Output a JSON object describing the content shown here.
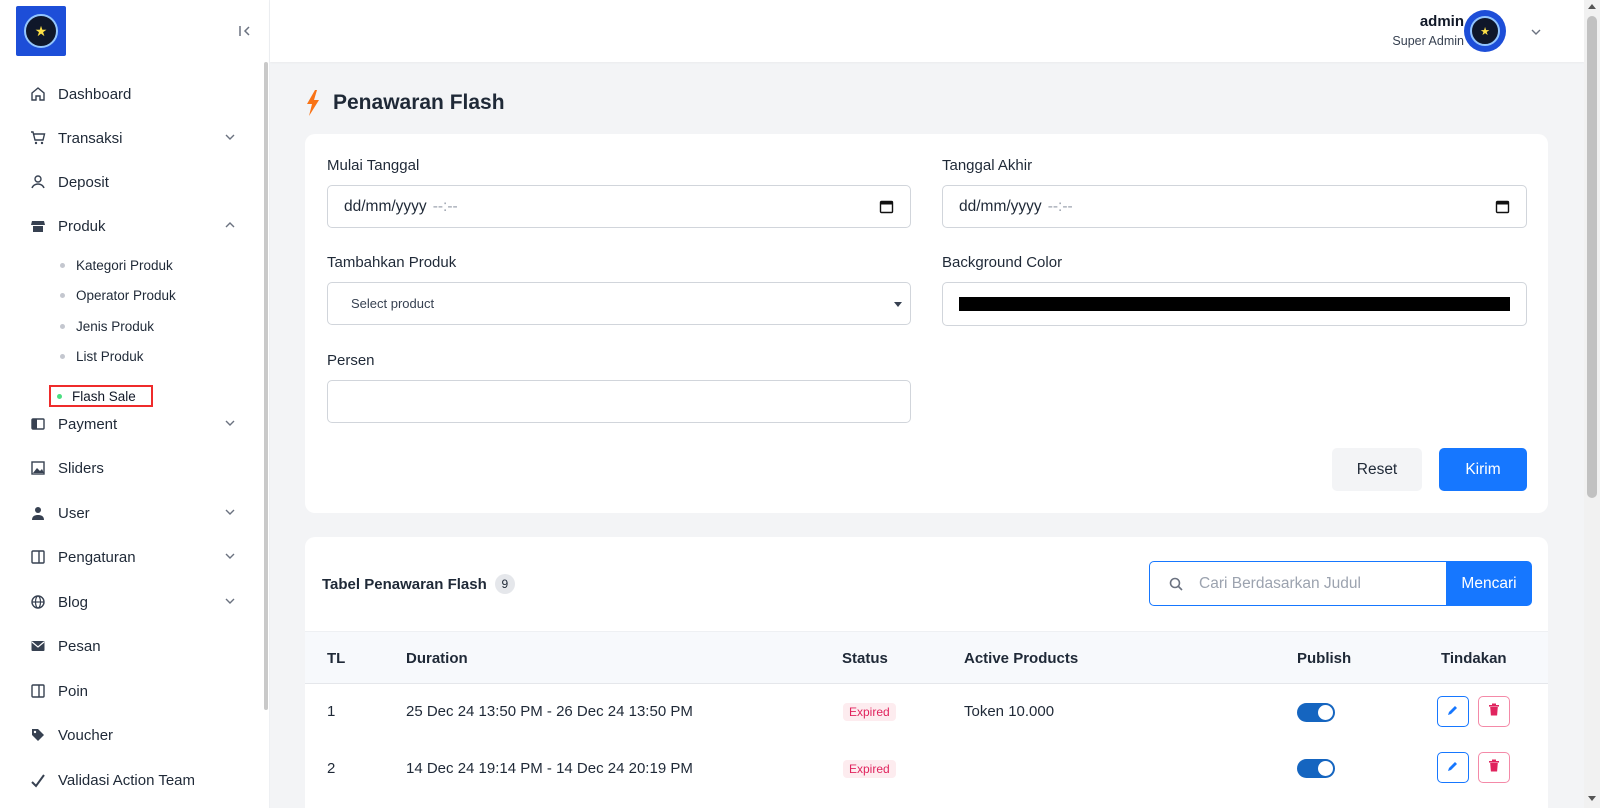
{
  "sidebar": {
    "items": [
      {
        "label": "Dashboard",
        "icon": "home-icon"
      },
      {
        "label": "Transaksi",
        "icon": "cart-icon"
      },
      {
        "label": "Deposit",
        "icon": "deposit-icon"
      },
      {
        "label": "Produk",
        "icon": "store-icon"
      },
      {
        "label": "Payment",
        "icon": "wallet-icon"
      },
      {
        "label": "Sliders",
        "icon": "image-icon"
      },
      {
        "label": "User",
        "icon": "user-icon"
      },
      {
        "label": "Pengaturan",
        "icon": "settings-icon"
      },
      {
        "label": "Blog",
        "icon": "globe-icon"
      },
      {
        "label": "Pesan",
        "icon": "mail-icon"
      },
      {
        "label": "Poin",
        "icon": "points-icon"
      },
      {
        "label": "Voucher",
        "icon": "tag-icon"
      },
      {
        "label": "Validasi Action Team",
        "icon": "check-icon"
      }
    ],
    "produk_sub": [
      {
        "label": "Kategori Produk"
      },
      {
        "label": "Operator Produk"
      },
      {
        "label": "Jenis Produk"
      },
      {
        "label": "List Produk"
      },
      {
        "label": "Flash Sale"
      }
    ]
  },
  "header": {
    "user_name": "admin",
    "user_role": "Super Admin"
  },
  "page": {
    "title": "Penawaran Flash"
  },
  "form": {
    "start_label": "Mulai Tanggal",
    "start_date_placeholder": "dd/mm/yyyy",
    "start_time_placeholder": "--:--",
    "end_label": "Tanggal Akhir",
    "end_date_placeholder": "dd/mm/yyyy",
    "end_time_placeholder": "--:--",
    "product_label": "Tambahkan Produk",
    "product_selected": "Select product",
    "bg_label": "Background Color",
    "bg_color": "#000000",
    "persen_label": "Persen",
    "persen_value": "",
    "reset_label": "Reset",
    "submit_label": "Kirim"
  },
  "table": {
    "title": "Tabel Penawaran Flash",
    "count": "9",
    "search_placeholder": "Cari Berdasarkan Judul",
    "search_button": "Mencari",
    "columns": [
      "TL",
      "Duration",
      "Status",
      "Active Products",
      "Publish",
      "Tindakan"
    ],
    "rows": [
      {
        "tl": "1",
        "duration": "25 Dec 24 13:50 PM - 26 Dec 24 13:50 PM",
        "status": "Expired",
        "products": "Token 10.000",
        "publish": true
      },
      {
        "tl": "2",
        "duration": "14 Dec 24 19:14 PM - 14 Dec 24 20:19 PM",
        "status": "Expired",
        "products": "",
        "publish": true
      }
    ]
  },
  "colors": {
    "primary": "#1677ff",
    "expired_text": "#e0245e",
    "active_dot": "#4ade80"
  }
}
